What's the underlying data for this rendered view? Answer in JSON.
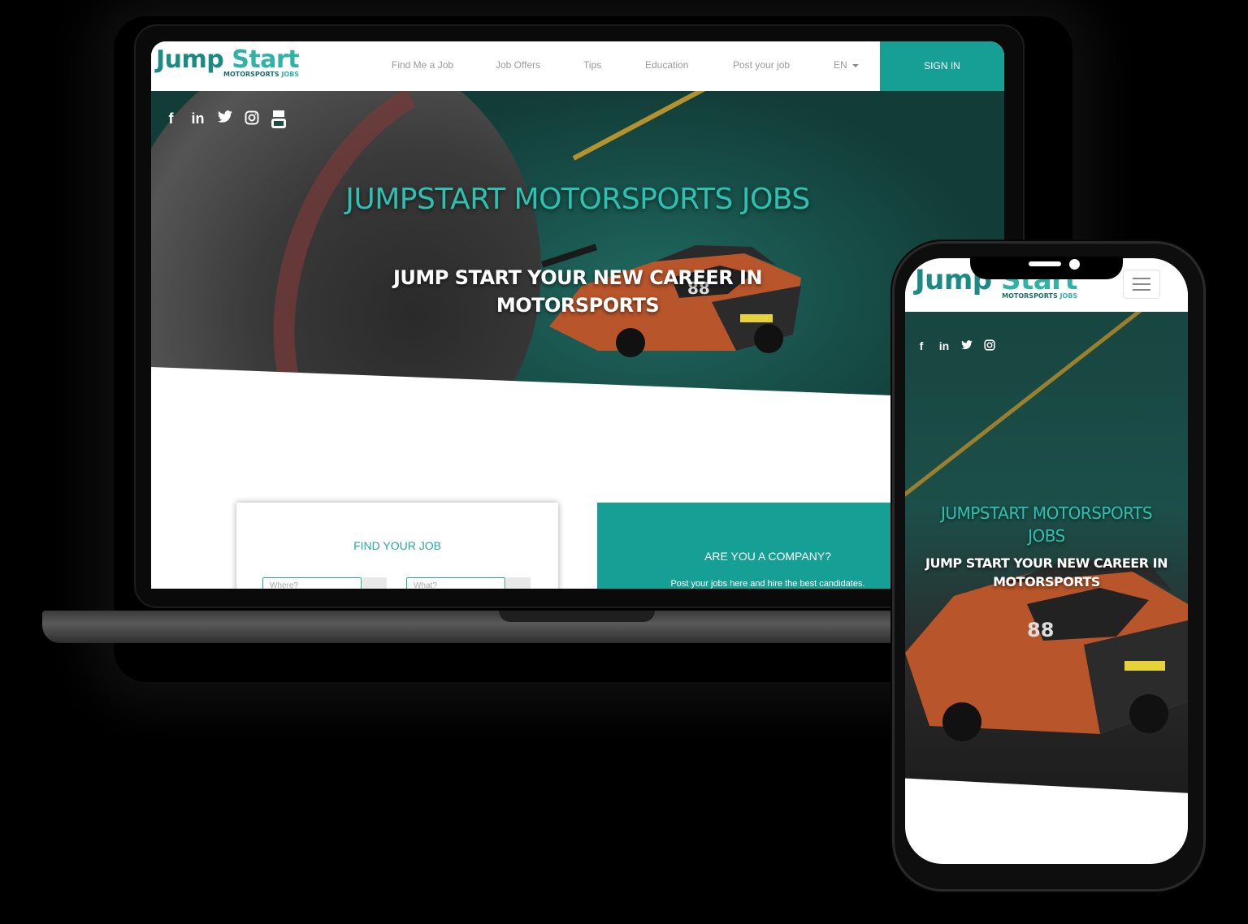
{
  "brand": {
    "logo_word1": "Jump",
    "logo_word2": "Start",
    "logo_sub1": "MOTORSPORTS",
    "logo_sub2": "JOBS"
  },
  "nav": {
    "items": [
      "Find Me a Job",
      "Job Offers",
      "Tips",
      "Education",
      "Post your job"
    ],
    "language": "EN",
    "signin": "SIGN IN"
  },
  "social_icons": [
    "facebook-icon",
    "linkedin-icon",
    "twitter-icon",
    "instagram-icon",
    "youtube-icon"
  ],
  "hero": {
    "title": "JUMPSTART MOTORSPORTS JOBS",
    "subtitle": "JUMP START YOUR NEW CAREER IN MOTORSPORTS"
  },
  "find_job": {
    "title": "FIND YOUR JOB",
    "where_placeholder": "Where?",
    "what_placeholder": "What?"
  },
  "company": {
    "title": "ARE YOU A COMPANY?",
    "description": "Post your jobs here and hire the best candidates."
  },
  "phone": {
    "hero_title": "JUMPSTART MOTORSPORTS JOBS",
    "hero_subtitle": "JUMP START YOUR NEW CAREER IN MOTORSPORTS"
  },
  "colors": {
    "accent": "#169f94",
    "accent_light": "#2cc1b1",
    "background": "#000000"
  }
}
